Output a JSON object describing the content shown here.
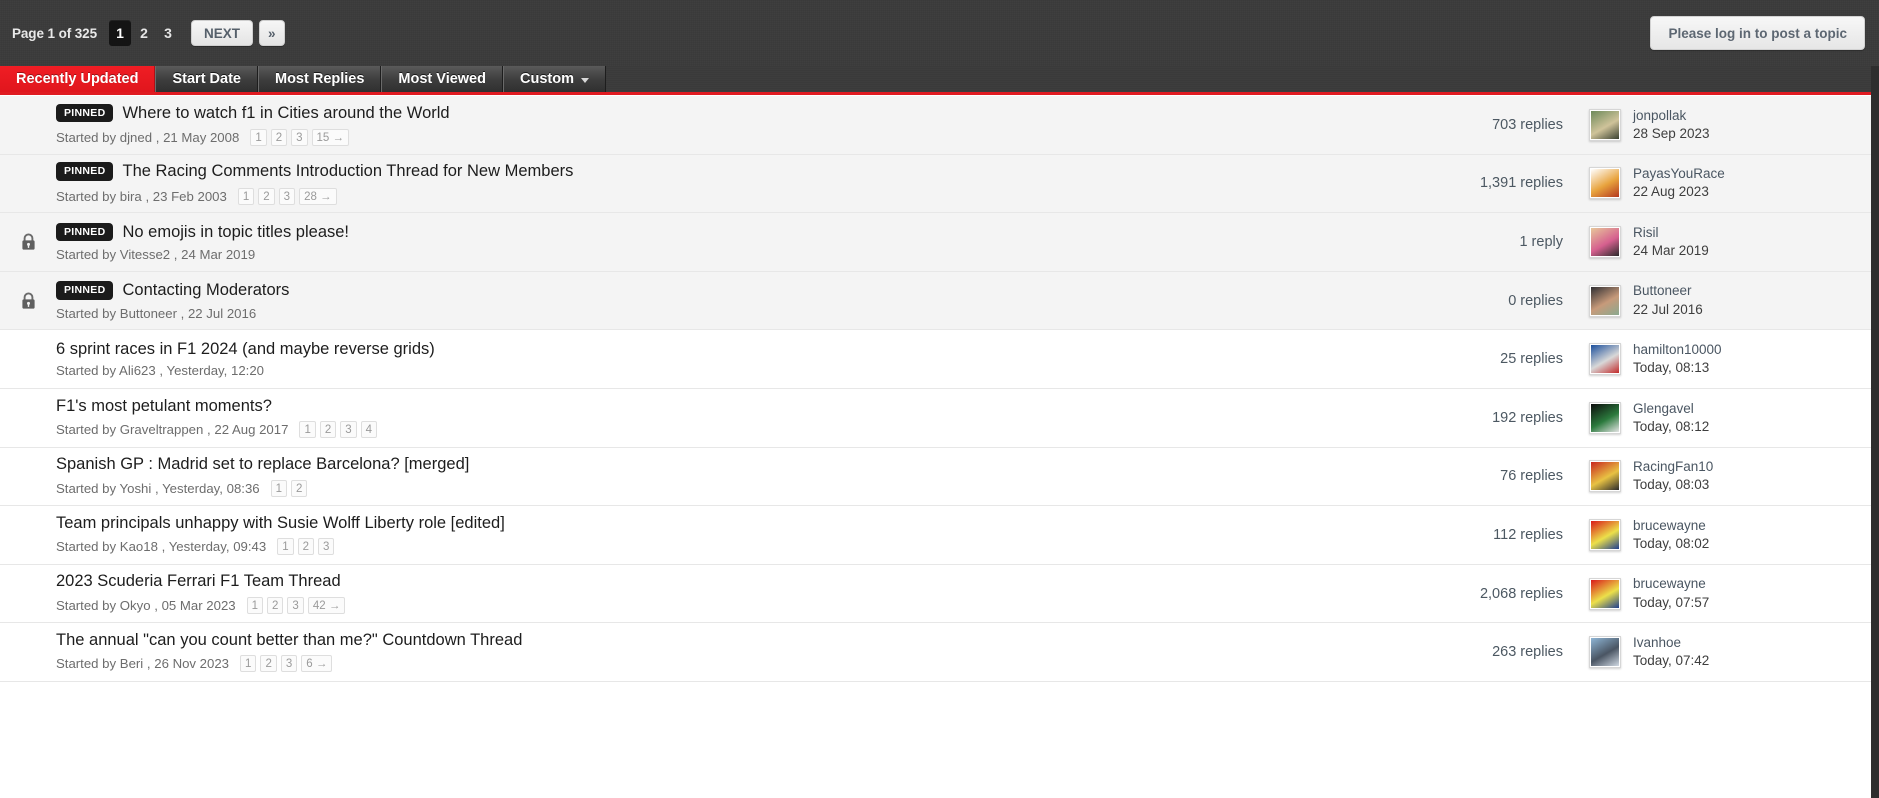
{
  "header": {
    "pagination": {
      "label": "Page 1 of 325",
      "pages": [
        "1",
        "2",
        "3"
      ],
      "active_page": "1",
      "next_label": "NEXT",
      "last_label": "»"
    },
    "post_topic_button": "Please log in to post a topic"
  },
  "tabs": [
    {
      "label": "Recently Updated",
      "active": true,
      "dropdown": false
    },
    {
      "label": "Start Date",
      "active": false,
      "dropdown": false
    },
    {
      "label": "Most Replies",
      "active": false,
      "dropdown": false
    },
    {
      "label": "Most Viewed",
      "active": false,
      "dropdown": false
    },
    {
      "label": "Custom",
      "active": false,
      "dropdown": true
    }
  ],
  "colors": {
    "accent": "#e01b21",
    "topbar": "#3b3b3b",
    "pinned_badge": "#1b1b1b",
    "row_shaded": "#f4f4f4",
    "row_plain": "#ffffff"
  },
  "started_by_prefix": "Started by",
  "topics": [
    {
      "pinned": true,
      "locked": false,
      "shaded": true,
      "title": "Where to watch f1 in Cities around the World",
      "starter": "djned",
      "start_date": "21 May 2008",
      "mini_pages": [
        "1",
        "2",
        "3",
        "15 →"
      ],
      "replies": "703 replies",
      "last_user": "jonpollak",
      "last_date": "28 Sep 2023",
      "avatar_colors": [
        "#6d8a5a",
        "#cfc39a",
        "#3b4232"
      ]
    },
    {
      "pinned": true,
      "locked": false,
      "shaded": true,
      "title": "The Racing Comments Introduction Thread for New Members",
      "starter": "bira",
      "start_date": "23 Feb 2003",
      "mini_pages": [
        "1",
        "2",
        "3",
        "28 →"
      ],
      "replies": "1,391 replies",
      "last_user": "PayasYouRace",
      "last_date": "22 Aug 2023",
      "avatar_colors": [
        "#ffffff",
        "#e8a33d",
        "#b4381f"
      ]
    },
    {
      "pinned": true,
      "locked": true,
      "shaded": true,
      "title": "No emojis in topic titles please!",
      "starter": "Vitesse2",
      "start_date": "24 Mar 2019",
      "mini_pages": [],
      "replies": "1 reply",
      "last_user": "Risil",
      "last_date": "24 Mar 2019",
      "avatar_colors": [
        "#e7c79a",
        "#d6608f",
        "#2b2b2b"
      ]
    },
    {
      "pinned": true,
      "locked": true,
      "shaded": true,
      "title": "Contacting Moderators",
      "starter": "Buttoneer",
      "start_date": "22 Jul 2016",
      "mini_pages": [],
      "replies": "0 replies",
      "last_user": "Buttoneer",
      "last_date": "22 Jul 2016",
      "avatar_colors": [
        "#2f2f33",
        "#c79a7a",
        "#8aa98f"
      ]
    },
    {
      "pinned": false,
      "locked": false,
      "shaded": false,
      "title": "6 sprint races in F1 2024 (and maybe reverse grids)",
      "starter": "Ali623",
      "start_date": "Yesterday, 12:20",
      "mini_pages": [],
      "replies": "25 replies",
      "last_user": "hamilton10000",
      "last_date": "Today, 08:13",
      "avatar_colors": [
        "#1b4f9c",
        "#d8d8d8",
        "#c22a2a"
      ]
    },
    {
      "pinned": false,
      "locked": false,
      "shaded": false,
      "title": "F1's most petulant moments?",
      "starter": "Graveltrappen",
      "start_date": "22 Aug 2017",
      "mini_pages": [
        "1",
        "2",
        "3",
        "4"
      ],
      "replies": "192 replies",
      "last_user": "Glengavel",
      "last_date": "Today, 08:12",
      "avatar_colors": [
        "#0c0c0c",
        "#2b7a3d",
        "#e4e4e4"
      ]
    },
    {
      "pinned": false,
      "locked": false,
      "shaded": false,
      "title": "Spanish GP : Madrid set to replace Barcelona? [merged]",
      "starter": "Yoshi",
      "start_date": "Yesterday, 08:36",
      "mini_pages": [
        "1",
        "2"
      ],
      "replies": "76 replies",
      "last_user": "RacingFan10",
      "last_date": "Today, 08:03",
      "avatar_colors": [
        "#c8261f",
        "#e8c243",
        "#2c2c2c"
      ]
    },
    {
      "pinned": false,
      "locked": false,
      "shaded": false,
      "title": "Team principals unhappy with Susie Wolff Liberty role [edited]",
      "starter": "Kao18",
      "start_date": "Yesterday, 09:43",
      "mini_pages": [
        "1",
        "2",
        "3"
      ],
      "replies": "112 replies",
      "last_user": "brucewayne",
      "last_date": "Today, 08:02",
      "avatar_colors": [
        "#d91a1a",
        "#ece04a",
        "#1f3f8f"
      ]
    },
    {
      "pinned": false,
      "locked": false,
      "shaded": false,
      "title": "2023 Scuderia Ferrari F1 Team Thread",
      "starter": "Okyo",
      "start_date": "05 Mar 2023",
      "mini_pages": [
        "1",
        "2",
        "3",
        "42 →"
      ],
      "replies": "2,068 replies",
      "last_user": "brucewayne",
      "last_date": "Today, 07:57",
      "avatar_colors": [
        "#d91a1a",
        "#ece04a",
        "#1f3f8f"
      ]
    },
    {
      "pinned": false,
      "locked": false,
      "shaded": false,
      "title": "The annual \"can you count better than me?\" Countdown Thread",
      "starter": "Beri",
      "start_date": "26 Nov 2023",
      "mini_pages": [
        "1",
        "2",
        "3",
        "6 →"
      ],
      "replies": "263 replies",
      "last_user": "Ivanhoe",
      "last_date": "Today, 07:42",
      "avatar_colors": [
        "#8fb6d6",
        "#4a5563",
        "#cfd8e2"
      ]
    }
  ]
}
